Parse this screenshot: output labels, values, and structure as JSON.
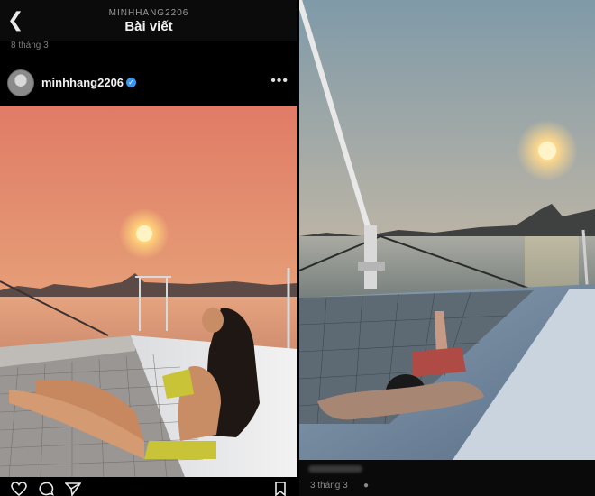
{
  "left_post": {
    "header": {
      "back_icon": "chevron-left-icon",
      "username_small": "MINHHANG2206",
      "title": "Bài viết"
    },
    "date_top": "8 tháng 3",
    "author": {
      "username": "minhhang2206",
      "verified": true,
      "more_icon": "more-options-icon"
    },
    "photo": {
      "description_icon": "photo"
    },
    "actions": [
      "heart-icon",
      "comment-icon",
      "share-icon",
      "bookmark-icon"
    ]
  },
  "right_post": {
    "photo": {
      "description_icon": "photo"
    },
    "date": "3 tháng 3",
    "visibility_icon": "globe-icon"
  },
  "colors": {
    "accent_verified": "#3897f0",
    "background": "#000000"
  }
}
